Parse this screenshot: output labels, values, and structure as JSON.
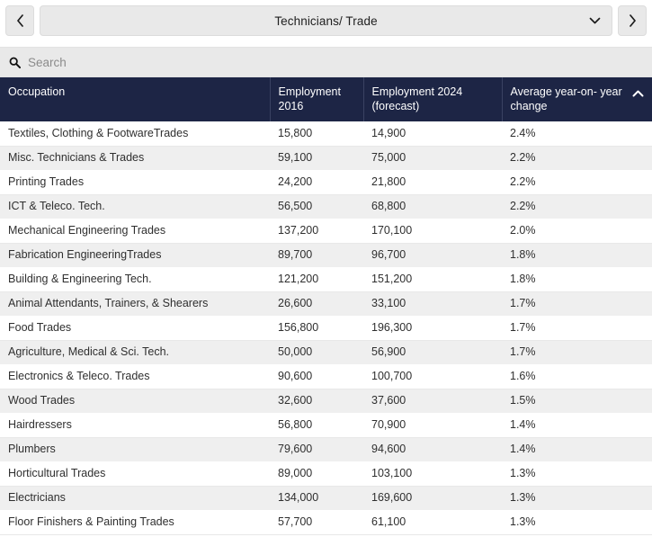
{
  "topbar": {
    "prev_label": "‹",
    "next_label": "›",
    "title": "Technicians/ Trade",
    "caret": "⌄"
  },
  "search": {
    "placeholder": "Search",
    "value": ""
  },
  "table": {
    "columns": [
      {
        "label": "Occupation",
        "sorted": false
      },
      {
        "label": "Employment 2016",
        "sorted": false
      },
      {
        "label": "Employment 2024 (forecast)",
        "sorted": false
      },
      {
        "label": "Average year-on- year change",
        "sorted": true,
        "sort_direction": "asc"
      }
    ],
    "rows": [
      {
        "occupation": "Textiles, Clothing & FootwareTrades",
        "employment_2016": "15,800",
        "employment_2024": "14,900",
        "avg_change": "2.4%"
      },
      {
        "occupation": "Misc. Technicians & Trades",
        "employment_2016": "59,100",
        "employment_2024": "75,000",
        "avg_change": "2.2%"
      },
      {
        "occupation": "Printing Trades",
        "employment_2016": "24,200",
        "employment_2024": "21,800",
        "avg_change": "2.2%"
      },
      {
        "occupation": "ICT & Teleco. Tech.",
        "employment_2016": "56,500",
        "employment_2024": "68,800",
        "avg_change": "2.2%"
      },
      {
        "occupation": "Mechanical Engineering Trades",
        "employment_2016": "137,200",
        "employment_2024": "170,100",
        "avg_change": "2.0%"
      },
      {
        "occupation": "Fabrication EngineeringTrades",
        "employment_2016": "89,700",
        "employment_2024": "96,700",
        "avg_change": "1.8%"
      },
      {
        "occupation": "Building & Engineering Tech.",
        "employment_2016": "121,200",
        "employment_2024": "151,200",
        "avg_change": "1.8%"
      },
      {
        "occupation": "Animal Attendants, Trainers, & Shearers",
        "employment_2016": "26,600",
        "employment_2024": "33,100",
        "avg_change": "1.7%"
      },
      {
        "occupation": "Food Trades",
        "employment_2016": "156,800",
        "employment_2024": "196,300",
        "avg_change": "1.7%"
      },
      {
        "occupation": "Agriculture, Medical & Sci. Tech.",
        "employment_2016": "50,000",
        "employment_2024": "56,900",
        "avg_change": "1.7%"
      },
      {
        "occupation": "Electronics & Teleco. Trades",
        "employment_2016": "90,600",
        "employment_2024": "100,700",
        "avg_change": "1.6%"
      },
      {
        "occupation": "Wood Trades",
        "employment_2016": "32,600",
        "employment_2024": "37,600",
        "avg_change": "1.5%"
      },
      {
        "occupation": "Hairdressers",
        "employment_2016": "56,800",
        "employment_2024": "70,900",
        "avg_change": "1.4%"
      },
      {
        "occupation": "Plumbers",
        "employment_2016": "79,600",
        "employment_2024": "94,600",
        "avg_change": "1.4%"
      },
      {
        "occupation": "Horticultural Trades",
        "employment_2016": "89,000",
        "employment_2024": "103,100",
        "avg_change": "1.3%"
      },
      {
        "occupation": "Electricians",
        "employment_2016": "134,000",
        "employment_2024": "169,600",
        "avg_change": "1.3%"
      },
      {
        "occupation": "Floor Finishers & Painting Trades",
        "employment_2016": "57,700",
        "employment_2024": "61,100",
        "avg_change": "1.3%"
      }
    ]
  },
  "colors": {
    "header_bg": "#1d2545",
    "header_text": "#ffffff",
    "row_alt_bg": "#efefef",
    "control_bg": "#e9e9e9"
  }
}
